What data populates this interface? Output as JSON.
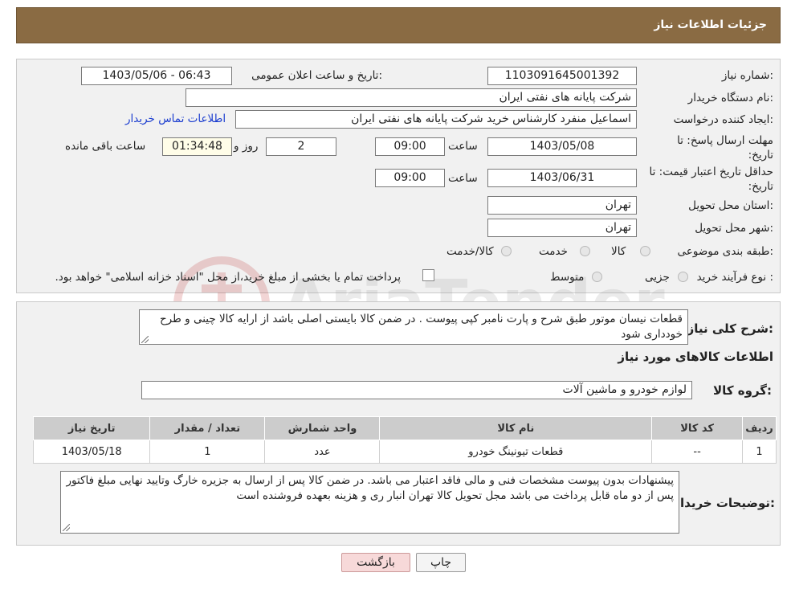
{
  "header": {
    "title": "جزئیات اطلاعات نیاز"
  },
  "watermark": {
    "text": "AriaTender.neT"
  },
  "form": {
    "need_number_label": "شماره نیاز:",
    "need_number": "1103091645001392",
    "announce_label": "تاریخ و ساعت اعلان عمومی:",
    "announce_value": "1403/05/06 - 06:43",
    "buyer_org_label": "نام دستگاه خریدار:",
    "buyer_org": "شرکت پایانه های نفتی ایران",
    "creator_label": "ایجاد کننده درخواست:",
    "creator": "اسماعیل  منفرد کارشناس خرید شرکت پایانه های نفتی ایران",
    "contact_link": "اطلاعات تماس خریدار",
    "deadline_label": "مهلت ارسال پاسخ: تا تاریخ:",
    "deadline_date": "1403/05/08",
    "time_label": "ساعت",
    "deadline_time": "09:00",
    "days_value": "2",
    "days_label": "روز و",
    "remaining_time": "01:34:48",
    "remaining_label": "ساعت باقی مانده",
    "validity_label": "حداقل تاریخ اعتبار قیمت: تا تاریخ:",
    "validity_date": "1403/06/31",
    "validity_time": "09:00",
    "province_label": "استان محل تحویل:",
    "province": "تهران",
    "city_label": "شهر محل تحویل:",
    "city": "تهران",
    "category_label": "طبقه بندی موضوعی:",
    "category_options": [
      "کالا",
      "خدمت",
      "کالا/خدمت"
    ],
    "process_label": "نوع فرآیند خرید :",
    "process_options": [
      "جزیی",
      "متوسط"
    ],
    "process_note": "پرداخت تمام یا بخشی از مبلغ خرید،از محل \"اسناد خزانه اسلامی\" خواهد بود."
  },
  "details": {
    "summary_label": "شرح کلی نیاز:",
    "summary": "قطعات نیسان موتور طبق شرح و پارت نامبر کپی پیوست . در ضمن کالا بایستی اصلی باشد از ارایه کالا چینی و طرح خودداری شود",
    "goods_info_title": "اطلاعات کالاهای مورد نیاز",
    "goods_group_label": "گروه کالا:",
    "goods_group": "لوازم خودرو و ماشین آلات",
    "table": {
      "headers": [
        "ردیف",
        "کد کالا",
        "نام کالا",
        "واحد شمارش",
        "تعداد / مقدار",
        "تاریخ نیاز"
      ],
      "rows": [
        [
          "1",
          "--",
          "قطعات تیونینگ خودرو",
          "عدد",
          "1",
          "1403/05/18"
        ]
      ]
    },
    "buyer_notes_label": "توضیحات خریدار:",
    "buyer_notes": "پیشنهادات بدون پیوست مشخصات فنی و مالی فاقد اعتبار می باشد. در ضمن کالا پس از ارسال به جزیره خارگ وتایید نهایی مبلغ فاکتور پس از دو ماه قابل پرداخت می باشد مجل تحویل کالا تهران انبار ری و هزینه بعهده فروشنده است"
  },
  "buttons": {
    "print": "چاپ",
    "back": "بازگشت"
  },
  "colors": {
    "header_bg": "#8a6b43",
    "panel_bg": "#f1f1f1",
    "link": "#1a3ccf",
    "back_btn_bg": "#f7d9d9"
  }
}
